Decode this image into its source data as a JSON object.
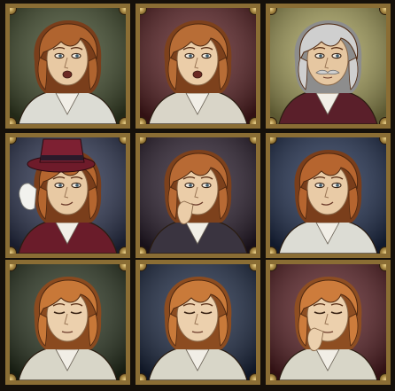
{
  "portraits": [
    {
      "id": "r1c1",
      "bg": "#3f4a2a",
      "hair": "#b0642f",
      "hair_dark": "#7a3e1b",
      "skin": "#e8c9a3",
      "expression": "open-mouth",
      "accessory": "none",
      "cloth": "#dcdcd4"
    },
    {
      "id": "r1c2",
      "bg": "#5a1f22",
      "hair": "#b86d36",
      "hair_dark": "#7d411c",
      "skin": "#ebcda8",
      "expression": "open-mouth",
      "accessory": "none",
      "cloth": "#d9d5c8"
    },
    {
      "id": "r1c3",
      "bg": "#a6a05a",
      "hair": "#cfcfcf",
      "hair_dark": "#8d8d8d",
      "skin": "#e6c7a1",
      "expression": "mustache",
      "accessory": "none",
      "cloth": "#5a1f2a"
    },
    {
      "id": "r2c1",
      "bg": "#2d3552",
      "hair": "#b5662f",
      "hair_dark": "#7a3e1b",
      "skin": "#e8c9a3",
      "expression": "smirk",
      "accessory": "top-hat",
      "cloth": "#6a1c2a"
    },
    {
      "id": "r2c2",
      "bg": "#2b1e2e",
      "hair": "#b86a34",
      "hair_dark": "#7d411c",
      "skin": "#ebcda8",
      "expression": "smirk",
      "accessory": "hand-chin",
      "cloth": "#3a3440"
    },
    {
      "id": "r2c3",
      "bg": "#1f2e4f",
      "hair": "#b6652f",
      "hair_dark": "#7a3e1b",
      "skin": "#e9cba6",
      "expression": "smirk",
      "accessory": "none",
      "cloth": "#dcdcd4"
    },
    {
      "id": "r3c1",
      "bg": "#2a3520",
      "hair": "#c87838",
      "hair_dark": "#8a4a1f",
      "skin": "#ecd0ad",
      "expression": "closed",
      "accessory": "none",
      "cloth": "#d8d6c8"
    },
    {
      "id": "r3c2",
      "bg": "#1d2a45",
      "hair": "#c97a3a",
      "hair_dark": "#8c4c20",
      "skin": "#ecd0ad",
      "expression": "closed",
      "accessory": "none",
      "cloth": "#d8d6c8"
    },
    {
      "id": "r3c3",
      "bg": "#5a1f24",
      "hair": "#cd7c3c",
      "hair_dark": "#8e4e22",
      "skin": "#ecd0ad",
      "expression": "closed",
      "accessory": "hand-chin",
      "cloth": "#d8d6c8"
    }
  ]
}
